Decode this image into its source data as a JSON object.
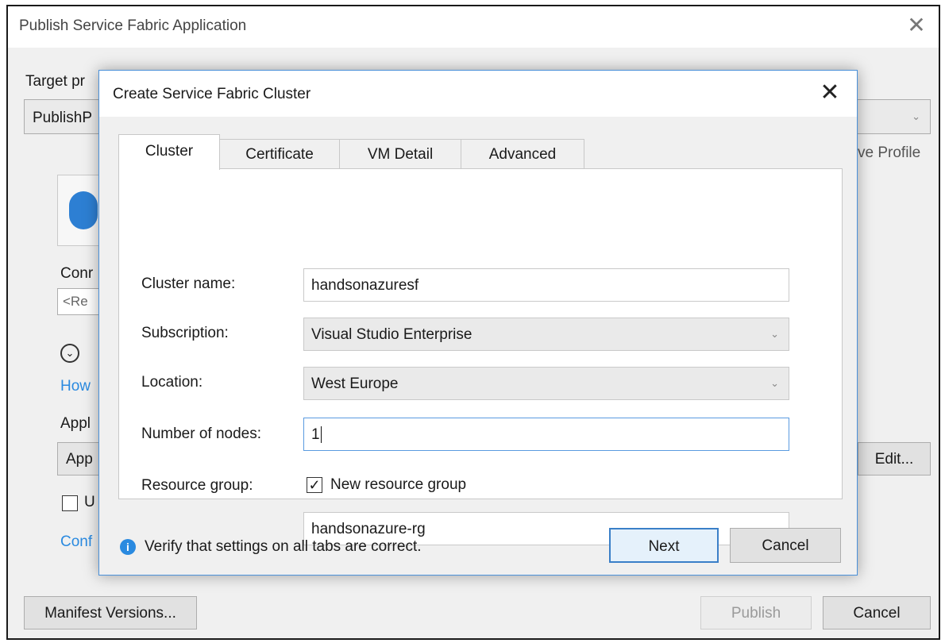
{
  "outer": {
    "title": "Publish Service Fabric Application",
    "target_profile_label": "Target pr",
    "target_profile_value": "PublishP",
    "save_profile_link": "ve Profile",
    "connection_label": "Conr",
    "connection_placeholder": "<Re",
    "advanced_label": "",
    "how_link": "How",
    "application_label": "Appl",
    "application_value": "App",
    "edit_button": "Edit...",
    "upgrade_label": "U",
    "configure_link": "Conf",
    "manifest_versions_button": "Manifest Versions...",
    "publish_button": "Publish",
    "cancel_button": "Cancel"
  },
  "dialog": {
    "title": "Create Service Fabric Cluster",
    "tabs": [
      {
        "label": "Cluster",
        "active": true
      },
      {
        "label": "Certificate",
        "active": false
      },
      {
        "label": "VM Detail",
        "active": false
      },
      {
        "label": "Advanced",
        "active": false
      }
    ],
    "cluster_name_label": "Cluster name:",
    "cluster_name_value": "handsonazuresf",
    "subscription_label": "Subscription:",
    "subscription_value": "Visual Studio Enterprise",
    "location_label": "Location:",
    "location_value": "West Europe",
    "nodes_label": "Number of nodes:",
    "nodes_value": "1",
    "resource_group_label": "Resource group:",
    "new_rg_label": "New resource group",
    "new_rg_checked": true,
    "resource_group_value": "handsonazure-rg",
    "info_text": "Verify that settings on all tabs are correct.",
    "next_button": "Next",
    "cancel_button": "Cancel"
  },
  "colors": {
    "accent": "#2a8ae0",
    "focus_border": "#4a90d9"
  }
}
